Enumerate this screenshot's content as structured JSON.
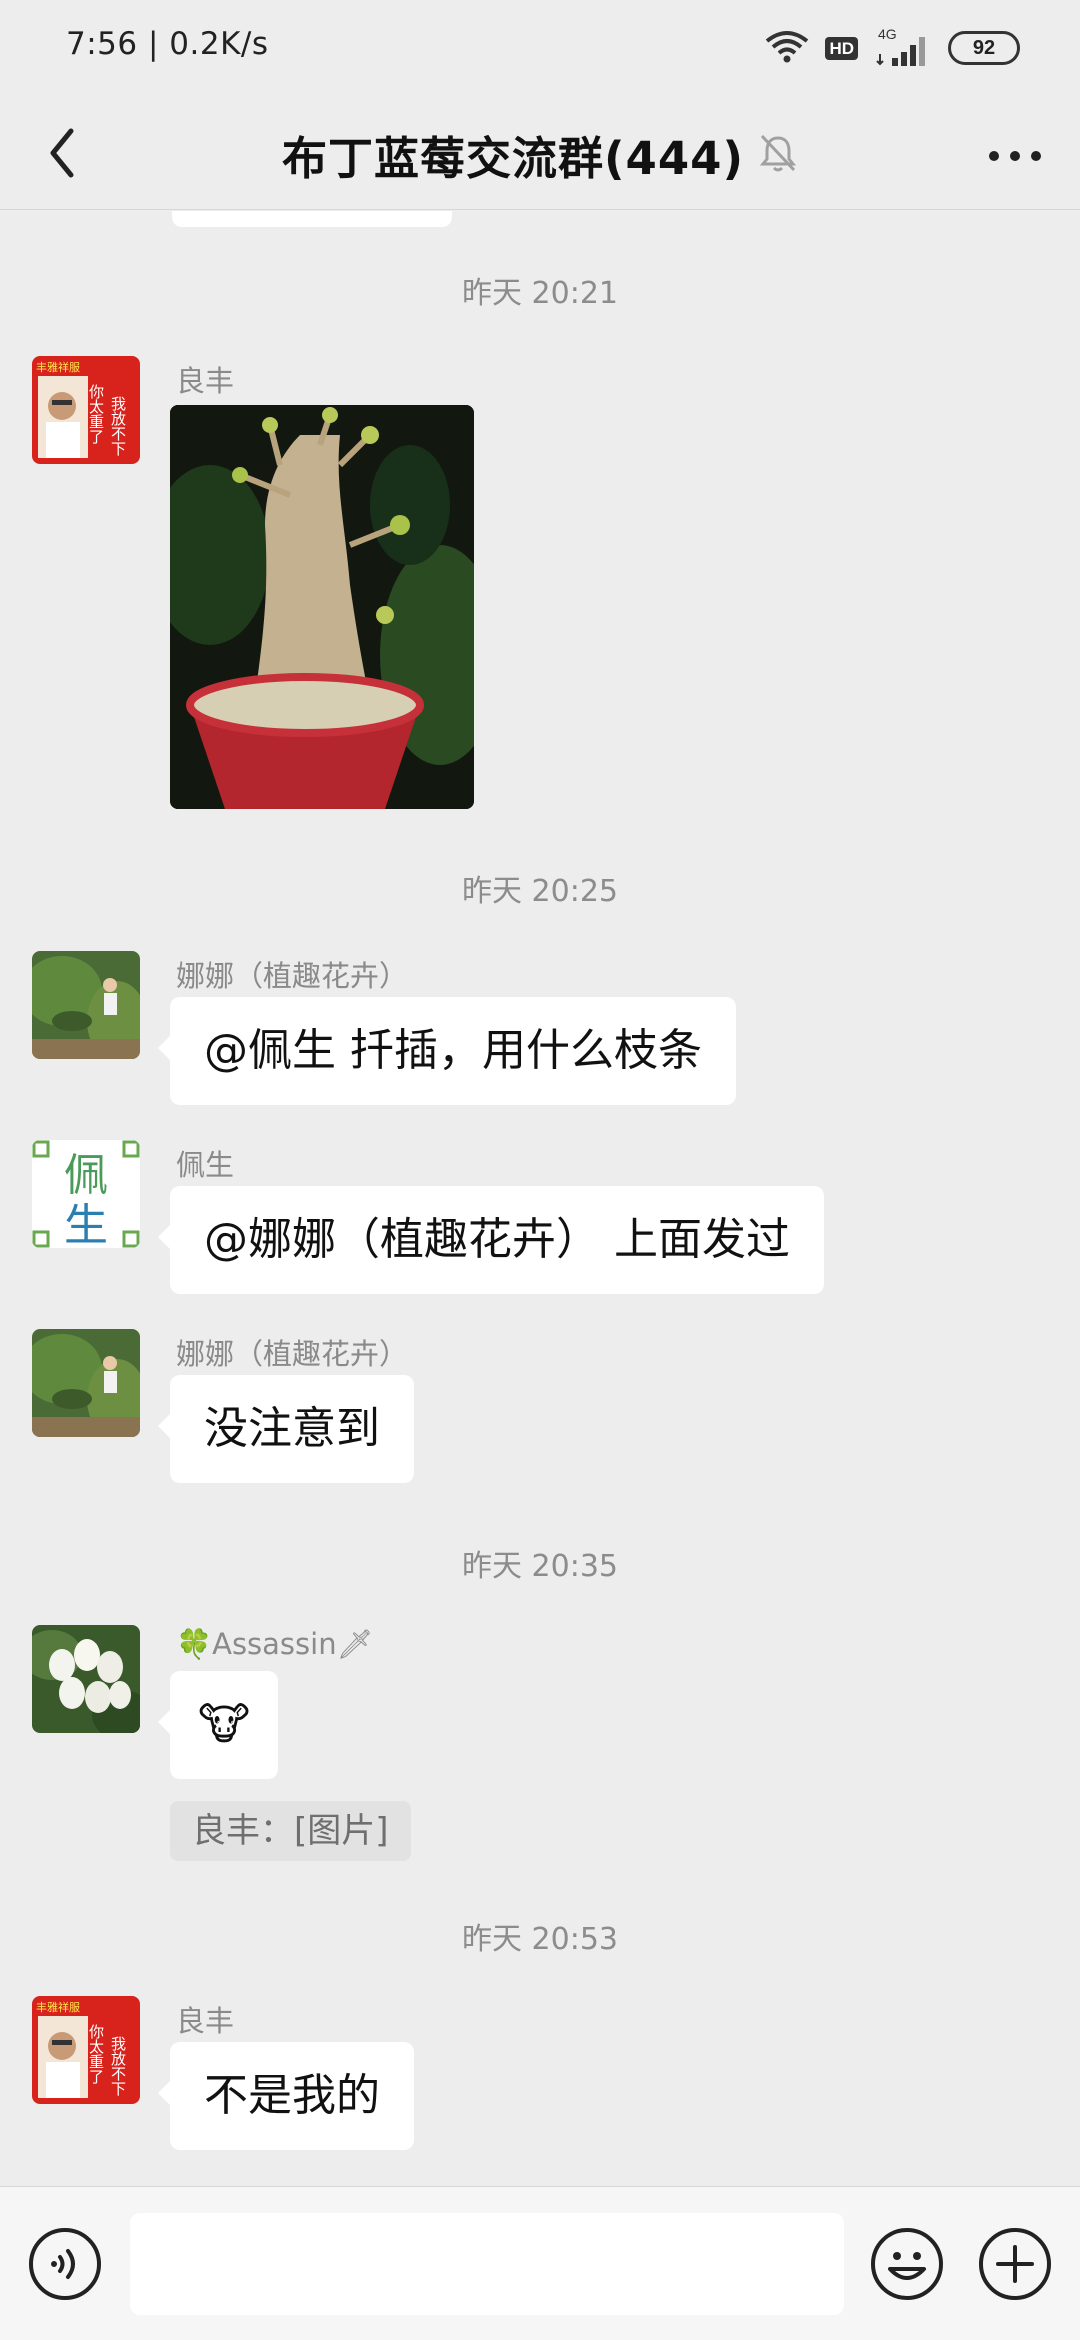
{
  "status_bar": {
    "time_speed": "7:56 | 0.2K/s",
    "hd": "HD",
    "network": "4G",
    "battery": "92"
  },
  "header": {
    "title": "布丁蓝莓交流群(444)"
  },
  "chat": {
    "time_1": "昨天 20:21",
    "msg_1": {
      "sender": "良丰"
    },
    "time_2": "昨天 20:25",
    "msg_2": {
      "sender": "娜娜（植趣花卉）",
      "text": "@佩生  扦插，用什么枝条"
    },
    "msg_3": {
      "sender": "佩生",
      "text": "@娜娜（植趣花卉） 上面发过",
      "avatar_chars": [
        "佩",
        "生"
      ]
    },
    "msg_4": {
      "sender": "娜娜（植趣花卉）",
      "text": "没注意到"
    },
    "time_3": "昨天 20:35",
    "msg_5": {
      "sender": "🍀Assassin🗡",
      "text": "🐮",
      "quote": "良丰：[图片]"
    },
    "time_4": "昨天 20:53",
    "msg_6": {
      "sender": "良丰",
      "text": "不是我的"
    },
    "avatar_liangfeng_lines": [
      "丰雅祥服",
      "你太重了",
      "我放不下"
    ]
  },
  "input": {
    "placeholder": ""
  }
}
